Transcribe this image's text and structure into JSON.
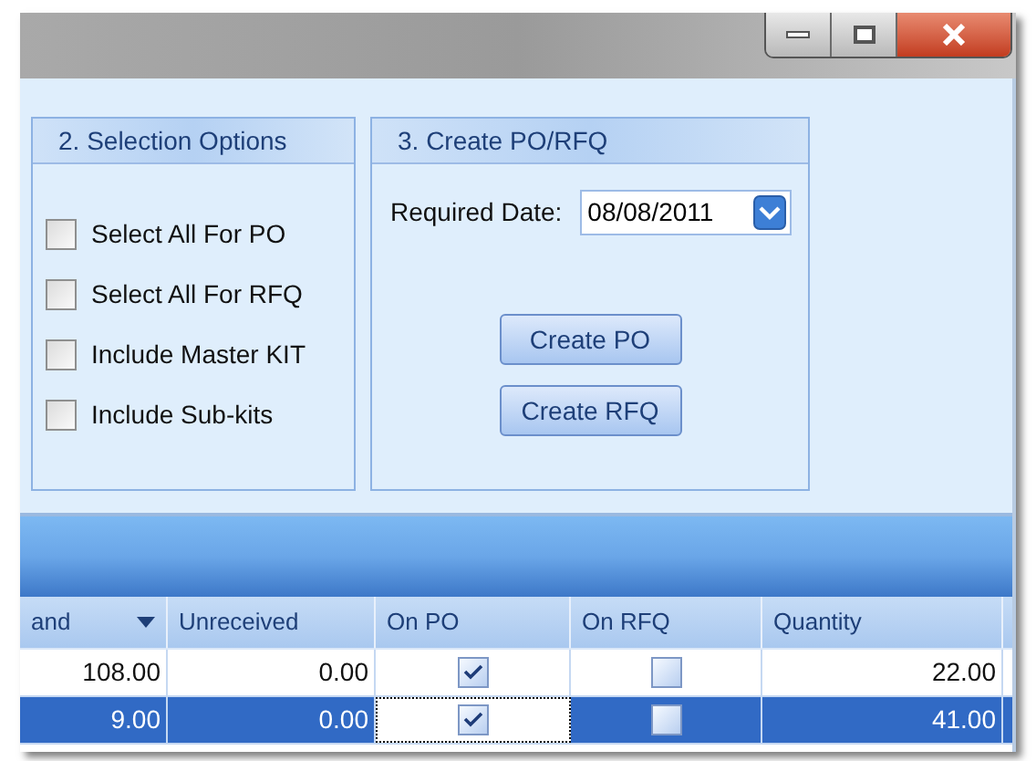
{
  "window": {
    "controls": [
      {
        "kind": "minimize"
      },
      {
        "kind": "maximize"
      },
      {
        "kind": "close"
      }
    ]
  },
  "selection_options": {
    "title": "2. Selection Options",
    "options": [
      {
        "label": "Select All For PO",
        "checked": false
      },
      {
        "label": "Select All For RFQ",
        "checked": false
      },
      {
        "label": "Include Master KIT",
        "checked": false
      },
      {
        "label": "Include Sub-kits",
        "checked": false
      }
    ]
  },
  "create_po_rfq": {
    "title": "3. Create PO/RFQ",
    "date_label": "Required Date:",
    "date_value": "08/08/2011",
    "buttons": [
      "Create PO",
      "Create RFQ"
    ]
  },
  "grid": {
    "columns": [
      {
        "label": "and",
        "sort_menu": true
      },
      {
        "label": "Unreceived",
        "sort_menu": false
      },
      {
        "label": "On PO",
        "sort_menu": false
      },
      {
        "label": "On RFQ",
        "sort_menu": false
      },
      {
        "label": "Quantity",
        "sort_menu": false
      }
    ],
    "rows": [
      {
        "selected": false,
        "cells": [
          {
            "kind": "text",
            "text": "108.00"
          },
          {
            "kind": "text",
            "text": "0.00"
          },
          {
            "kind": "check",
            "checked": true,
            "focused": false
          },
          {
            "kind": "check",
            "checked": false,
            "focused": false
          },
          {
            "kind": "text",
            "text": "22.00"
          }
        ]
      },
      {
        "selected": true,
        "cells": [
          {
            "kind": "text",
            "text": "9.00"
          },
          {
            "kind": "text",
            "text": "0.00"
          },
          {
            "kind": "check",
            "checked": true,
            "focused": true
          },
          {
            "kind": "check",
            "checked": false,
            "focused": false
          },
          {
            "kind": "text",
            "text": "41.00"
          }
        ]
      }
    ]
  }
}
